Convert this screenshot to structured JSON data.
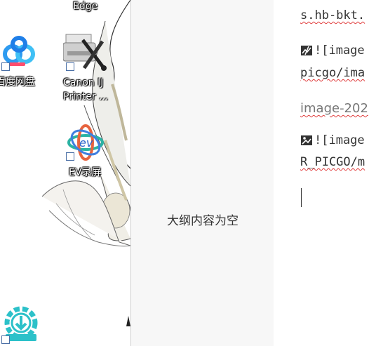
{
  "desktop": {
    "icons": [
      {
        "label": "Edge"
      },
      {
        "label": "百度网盘"
      },
      {
        "label_line1": "Canon IJ",
        "label_line2": "Printer ..."
      },
      {
        "label": "EV录屏"
      }
    ]
  },
  "outline": {
    "empty_text": "大纲内容为空"
  },
  "editor": {
    "line1": "s.hb-bkt.",
    "line2_prefix": "![image",
    "line3": "picgo/ima",
    "line4": "image-202",
    "line5_prefix": "![image",
    "line6": "R_PICGO/m"
  },
  "colors": {
    "outline_bg": "#f7f7f7",
    "squiggle": "#e03c3c"
  }
}
